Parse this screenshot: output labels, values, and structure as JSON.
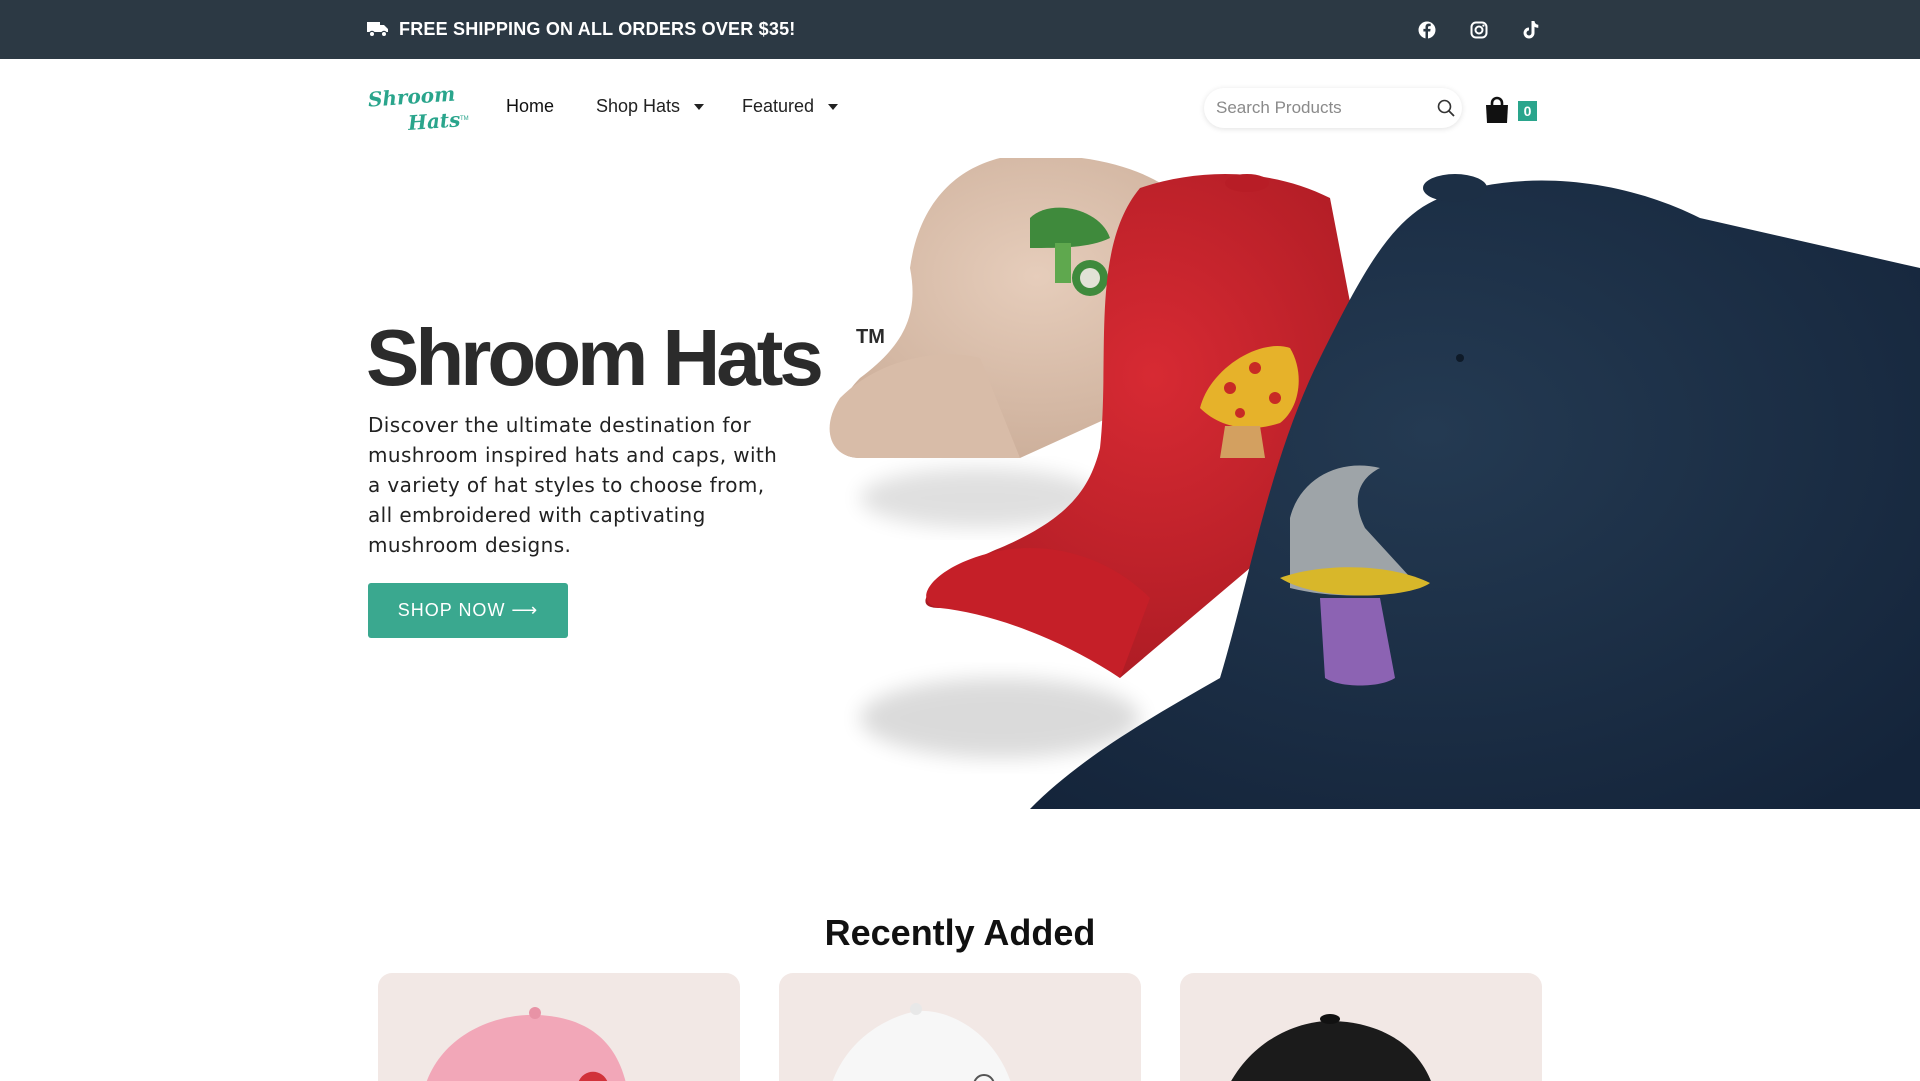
{
  "promo": {
    "text": "FREE SHIPPING ON ALL ORDERS OVER $35!",
    "icon": "truck-icon"
  },
  "social": [
    {
      "name": "facebook-icon"
    },
    {
      "name": "instagram-icon"
    },
    {
      "name": "tiktok-icon"
    }
  ],
  "logo": {
    "line1": "Shroom",
    "line2": "Hats",
    "mark": "™",
    "color": "#2aa58c"
  },
  "nav": {
    "home": "Home",
    "shop_hats": "Shop Hats",
    "featured": "Featured"
  },
  "search": {
    "placeholder": "Search Products",
    "value": ""
  },
  "cart": {
    "count": "0"
  },
  "hero": {
    "title": "Shroom Hats",
    "tm": "TM",
    "description": "Discover the ultimate destination for mushroom inspired hats and caps, with a variety of hat styles to choose from, all embroidered with captivating mushroom designs.",
    "cta": "SHOP NOW ⟶"
  },
  "recent": {
    "title": "Recently Added",
    "products": [
      {
        "hat_color": "#f2a7b8"
      },
      {
        "hat_color": "#f7f7f7"
      },
      {
        "hat_color": "#1b1b1b"
      }
    ]
  },
  "colors": {
    "topbar": "#2c3944",
    "accent": "#3aa88f",
    "card_bg": "#f2e8e5"
  }
}
